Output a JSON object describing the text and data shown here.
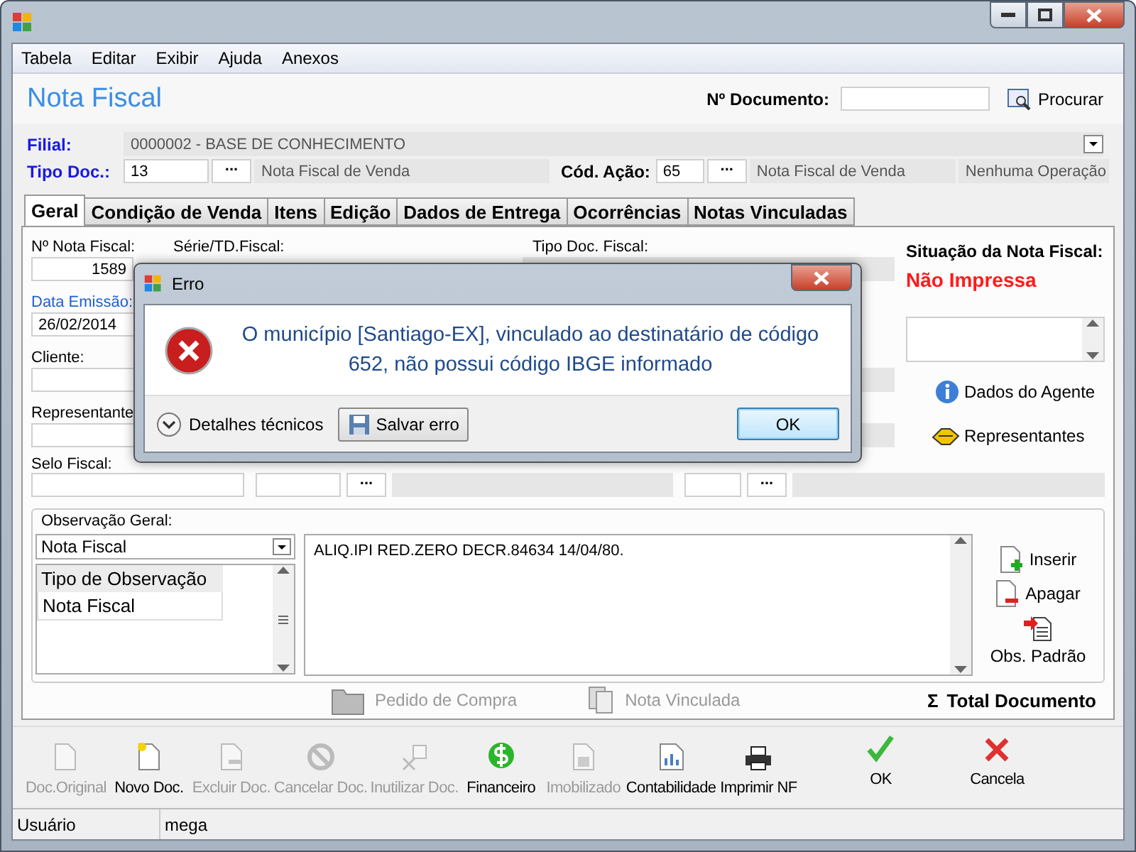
{
  "menu": [
    "Tabela",
    "Editar",
    "Exibir",
    "Ajuda",
    "Anexos"
  ],
  "header": {
    "title": "Nota Fiscal",
    "doc_number_label": "Nº Documento:",
    "search_button": "Procurar"
  },
  "filial": {
    "label": "Filial:",
    "value": "0000002 - BASE DE CONHECIMENTO"
  },
  "tipo_doc": {
    "label": "Tipo Doc.:",
    "code": "13",
    "picker": "...",
    "description": "Nota Fiscal de Venda"
  },
  "cod_acao": {
    "label": "Cód. Ação:",
    "code": "65",
    "picker": "...",
    "description": "Nota Fiscal de Venda",
    "operation": "Nenhuma Operação"
  },
  "tabs": [
    {
      "label": "Geral",
      "selected": true
    },
    {
      "label": "Condição de Venda",
      "selected": false
    },
    {
      "label": "Itens",
      "selected": false
    },
    {
      "label": "Edição",
      "selected": false
    },
    {
      "label": "Dados de Entrega",
      "selected": false
    },
    {
      "label": "Ocorrências",
      "selected": false
    },
    {
      "label": "Notas Vinculadas",
      "selected": false
    }
  ],
  "form": {
    "nota_label": "Nº Nota Fiscal:",
    "nota_value": "1589",
    "serie_label": "Série/TD.Fiscal:",
    "tipo_fiscal_label": "Tipo Doc. Fiscal:",
    "data_label": "Data Emissão:",
    "data_value": "26/02/2014",
    "cliente_label": "Cliente:",
    "representante_label": "Representante",
    "selo_label": "Selo Fiscal:",
    "selo_pickers": [
      "...",
      "..."
    ]
  },
  "situacao": {
    "label": "Situação da Nota Fiscal:",
    "value": "Não Impressa",
    "agent_button": "Dados do Agente",
    "reps_button": "Representantes"
  },
  "observacao": {
    "legend": "Observação Geral:",
    "select": "Nota Fiscal",
    "list_header": "Tipo de Observação",
    "list_items": [
      "Nota Fiscal"
    ],
    "text": "ALIQ.IPI RED.ZERO DECR.84634 14/04/80.",
    "buttons": [
      {
        "label": "Inserir",
        "kind": "add"
      },
      {
        "label": "Apagar",
        "kind": "remove"
      },
      {
        "label": "Obs. Padrão",
        "kind": "standard"
      }
    ]
  },
  "links": [
    {
      "label": "Pedido de Compra",
      "kind": "folder",
      "disabled": true
    },
    {
      "label": "Nota Vinculada",
      "kind": "pages",
      "disabled": true
    }
  ],
  "total": {
    "symbol": "Σ",
    "label": "Total Documento"
  },
  "toolbar": [
    {
      "label": "Doc.Original",
      "kind": "doc",
      "disabled": true
    },
    {
      "label": "Novo Doc.",
      "kind": "new",
      "disabled": false
    },
    {
      "label": "Excluir Doc.",
      "kind": "delete",
      "disabled": true
    },
    {
      "label": "Cancelar Doc.",
      "kind": "cancel",
      "disabled": true
    },
    {
      "label": "Inutilizar Doc.",
      "kind": "void",
      "disabled": true
    },
    {
      "label": "Financeiro",
      "kind": "money",
      "disabled": false
    },
    {
      "label": "Imobilizado",
      "kind": "lock",
      "disabled": true
    },
    {
      "label": "Contabilidade",
      "kind": "chart",
      "disabled": false
    },
    {
      "label": "Imprimir NF",
      "kind": "printer",
      "disabled": false
    },
    {
      "label": "OK",
      "kind": "check",
      "disabled": false
    },
    {
      "label": "Cancela",
      "kind": "cross",
      "disabled": false
    }
  ],
  "status_bar": [
    "Usuário",
    "mega"
  ],
  "dialog": {
    "title": "Erro",
    "message": "O município [Santiago-EX], vinculado ao destinatário de código 652, não possui código IBGE informado",
    "details": "Detalhes técnicos",
    "save_button": "Salvar erro",
    "ok_button": "OK"
  }
}
